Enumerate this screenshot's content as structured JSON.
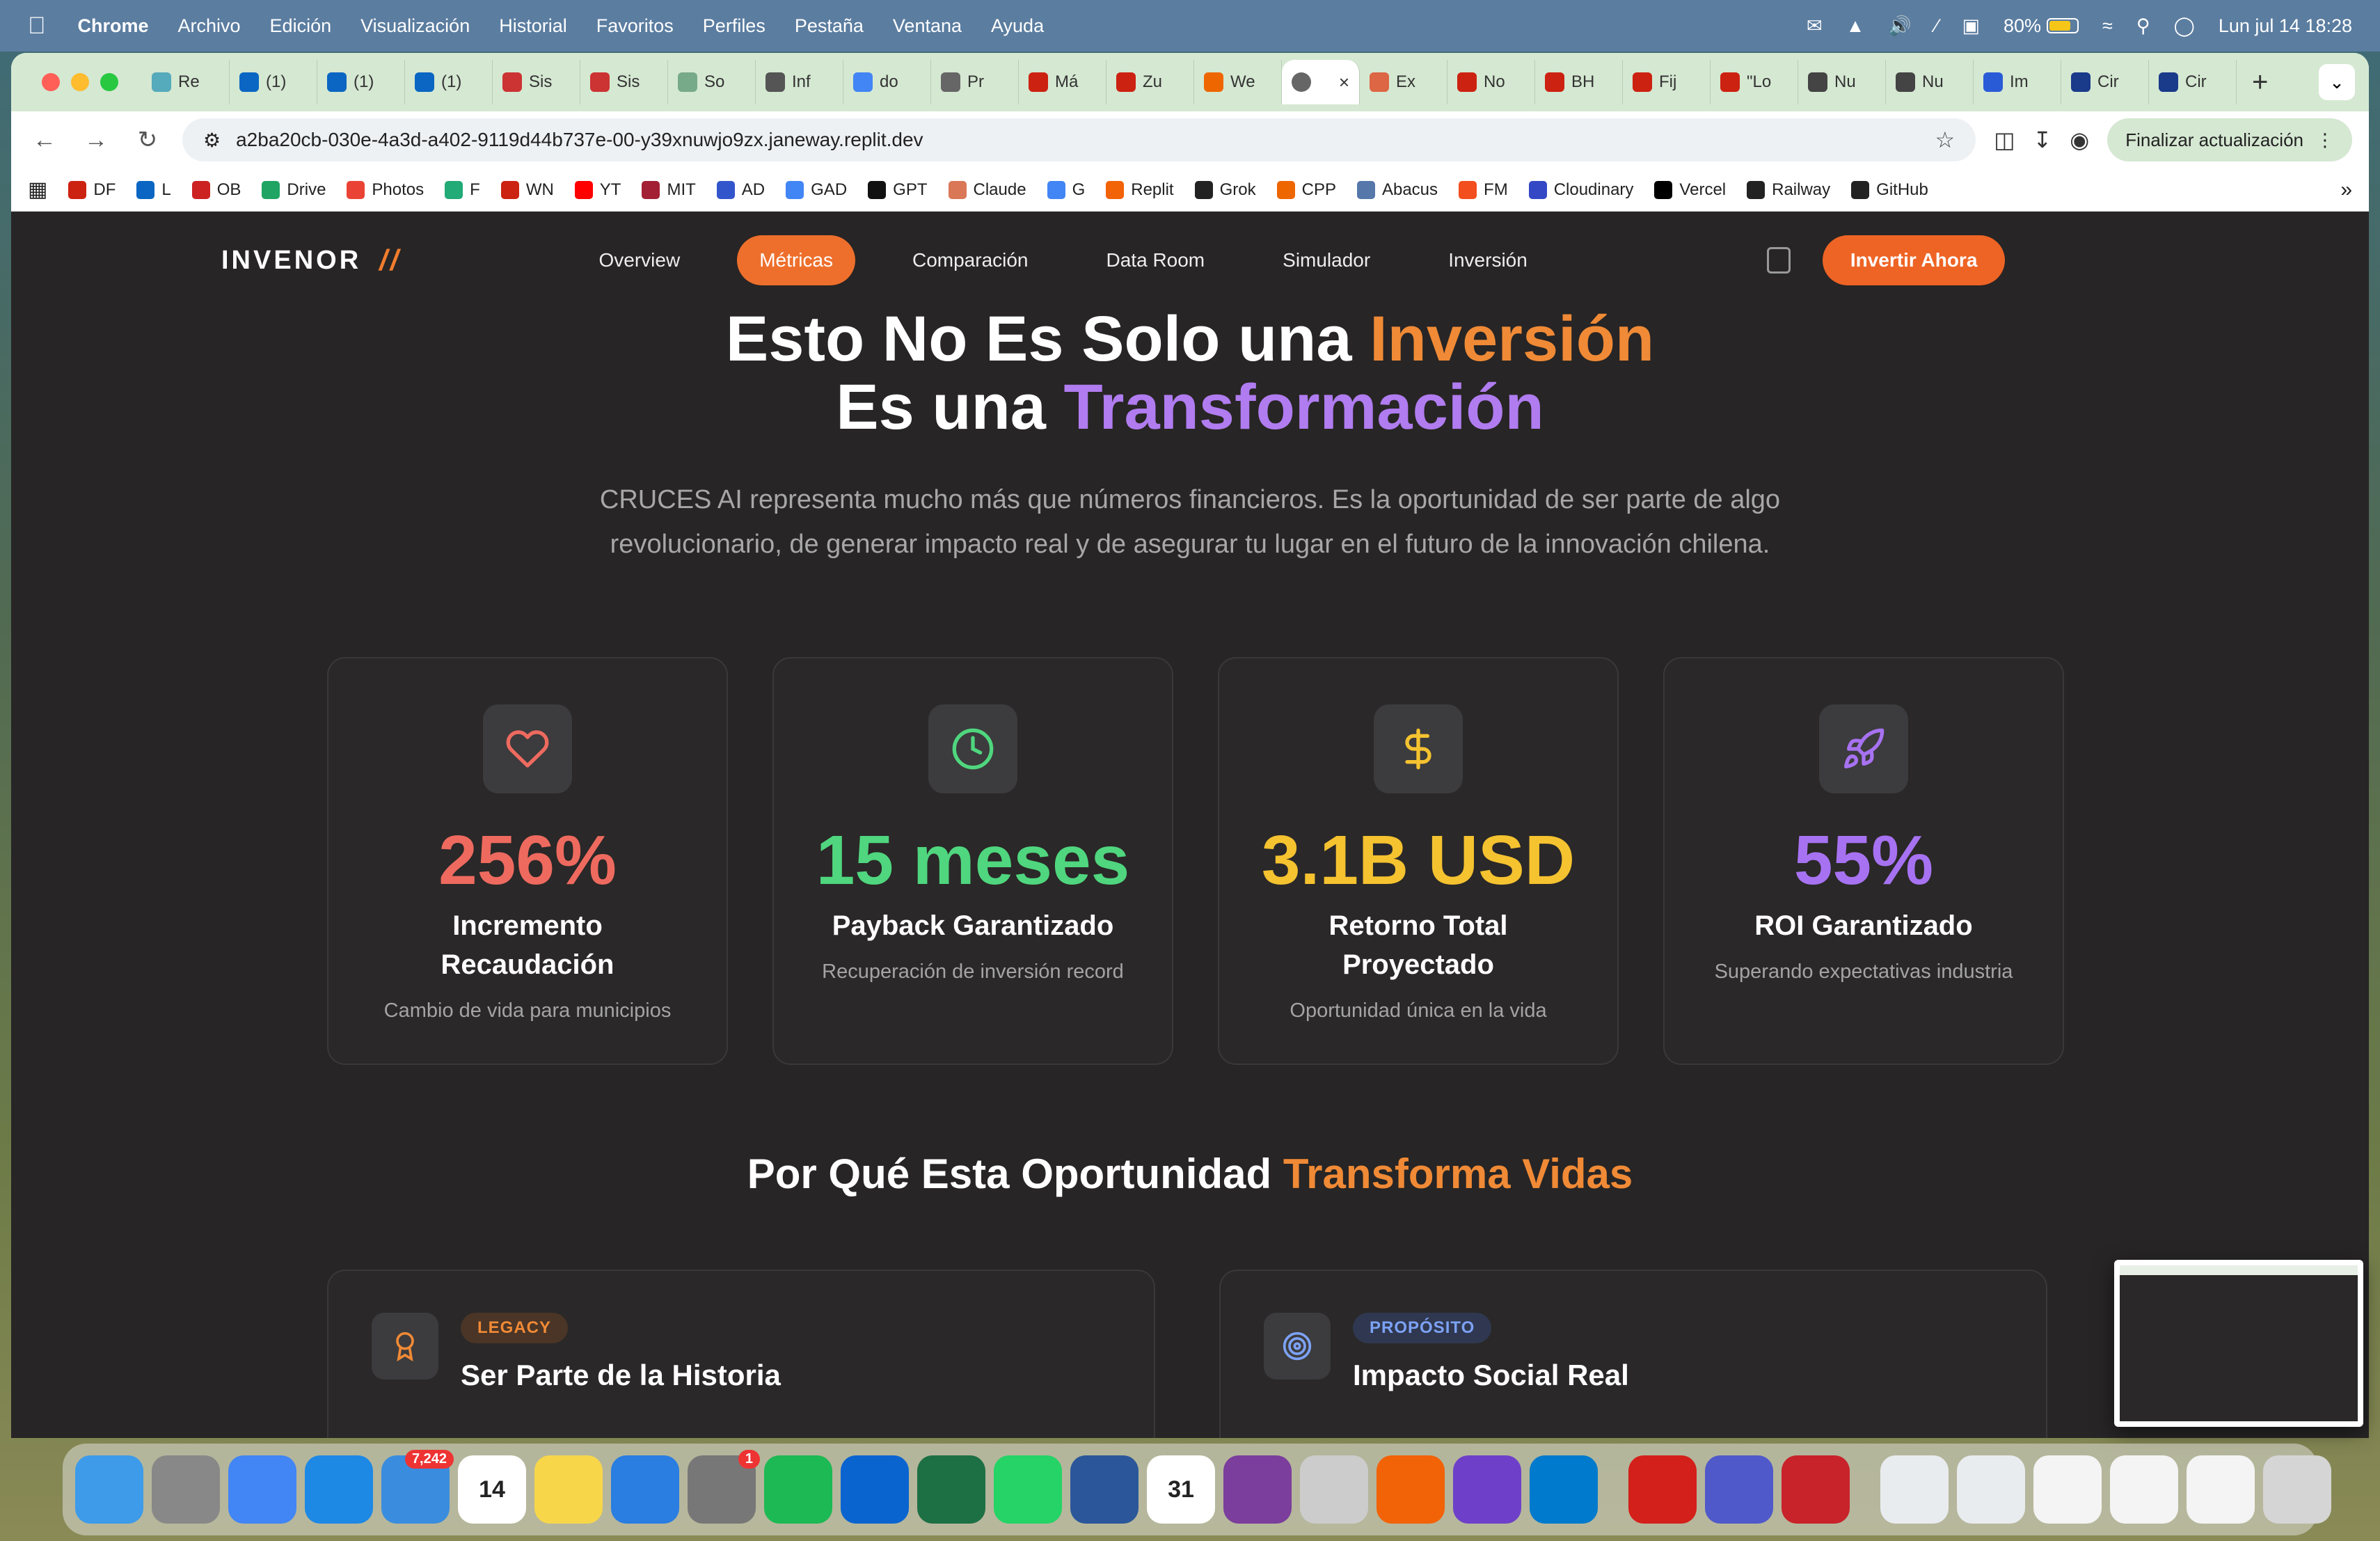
{
  "menubar": {
    "app": "Chrome",
    "items": [
      "Archivo",
      "Edición",
      "Visualización",
      "Historial",
      "Favoritos",
      "Perfiles",
      "Pestaña",
      "Ventana",
      "Ayuda"
    ],
    "battery": "80%",
    "datetime": "Lun jul 14  18:28"
  },
  "tabs": [
    {
      "label": "Re",
      "color": "#5ab"
    },
    {
      "label": "(1)",
      "color": "#0a66c2"
    },
    {
      "label": "(1)",
      "color": "#0a66c2"
    },
    {
      "label": "(1)",
      "color": "#0a66c2"
    },
    {
      "label": "Sis",
      "color": "#c33"
    },
    {
      "label": "Sis",
      "color": "#c33"
    },
    {
      "label": "So",
      "color": "#7a8"
    },
    {
      "label": "Inf",
      "color": "#555"
    },
    {
      "label": "do",
      "color": "#4285f4"
    },
    {
      "label": "Pr",
      "color": "#666"
    },
    {
      "label": "Má",
      "color": "#c21"
    },
    {
      "label": "Zu",
      "color": "#c21"
    },
    {
      "label": "We",
      "color": "#e60"
    },
    {
      "label": "Ex",
      "color": "#d64"
    },
    {
      "label": "No",
      "color": "#c21"
    },
    {
      "label": "BH",
      "color": "#c21"
    },
    {
      "label": "Fij",
      "color": "#c21"
    },
    {
      "label": "\"Lo",
      "color": "#c21"
    },
    {
      "label": "Nu",
      "color": "#444"
    },
    {
      "label": "Nu",
      "color": "#444"
    },
    {
      "label": "Im",
      "color": "#2a5bd7"
    },
    {
      "label": "Cir",
      "color": "#1a3a8a"
    },
    {
      "label": "Cir",
      "color": "#1a3a8a"
    }
  ],
  "active_tab": {
    "label": "",
    "close": "×"
  },
  "address_bar": {
    "url": "a2ba20cb-030e-4a3d-a402-9119d44b737e-00-y39xnuwjo9zx.janeway.replit.dev",
    "update_button": "Finalizar actualización"
  },
  "bookmarks": [
    {
      "label": "DF",
      "color": "#c21"
    },
    {
      "label": "L",
      "color": "#0a66c2"
    },
    {
      "label": "OB",
      "color": "#c22"
    },
    {
      "label": "Drive",
      "color": "#1fa463"
    },
    {
      "label": "Photos",
      "color": "#ea4335"
    },
    {
      "label": "F",
      "color": "#2a7"
    },
    {
      "label": "WN",
      "color": "#c21"
    },
    {
      "label": "YT",
      "color": "#f00"
    },
    {
      "label": "MIT",
      "color": "#a31f34"
    },
    {
      "label": "AD",
      "color": "#35c"
    },
    {
      "label": "GAD",
      "color": "#4285f4"
    },
    {
      "label": "GPT",
      "color": "#111"
    },
    {
      "label": "Claude",
      "color": "#d97757"
    },
    {
      "label": "G",
      "color": "#4285f4"
    },
    {
      "label": "Replit",
      "color": "#f26207"
    },
    {
      "label": "Grok",
      "color": "#222"
    },
    {
      "label": "CPP",
      "color": "#e60"
    },
    {
      "label": "Abacus",
      "color": "#57a"
    },
    {
      "label": "FM",
      "color": "#f24e1e"
    },
    {
      "label": "Cloudinary",
      "color": "#3448c5"
    },
    {
      "label": "Vercel",
      "color": "#000"
    },
    {
      "label": "Railway",
      "color": "#222"
    },
    {
      "label": "GitHub",
      "color": "#222"
    }
  ],
  "site": {
    "logo": "INVENOR",
    "nav": [
      "Overview",
      "Métricas",
      "Comparación",
      "Data Room",
      "Simulador",
      "Inversión"
    ],
    "active_nav": "Métricas",
    "cta": "Invertir Ahora",
    "hero": {
      "line1_a": "Esto No Es Solo una ",
      "line1_b": "Inversión",
      "line2_a": "Es una ",
      "line2_b": "Transformación",
      "lead": "CRUCES AI representa mucho más que números financieros. Es la oportunidad de ser parte de algo revolucionario, de generar impacto real y de asegurar tu lugar en el futuro de la innovación chilena."
    },
    "metrics": [
      {
        "value": "256%",
        "label": "Incremento Recaudación",
        "sub": "Cambio de vida para municipios",
        "color": "#ee6a5f",
        "icon": "heart-icon"
      },
      {
        "value": "15 meses",
        "label": "Payback Garantizado",
        "sub": "Recuperación de inversión record",
        "color": "#4fd67e",
        "icon": "clock-icon"
      },
      {
        "value": "3.1B USD",
        "label": "Retorno Total Proyectado",
        "sub": "Oportunidad única en la vida",
        "color": "#f5c230",
        "icon": "dollar-icon"
      },
      {
        "value": "55%",
        "label": "ROI Garantizado",
        "sub": "Superando expectativas industria",
        "color": "#a772f2",
        "icon": "rocket-icon"
      }
    ],
    "section2": {
      "a": "Por Qué Esta Oportunidad ",
      "b": "Transforma Vidas"
    },
    "reasons": [
      {
        "badge": "LEGACY",
        "title": "Ser Parte de la Historia",
        "badge_color": "#f08a36",
        "badge_bg": "#4a3526",
        "icon": "award-icon"
      },
      {
        "badge": "PROPÓSITO",
        "title": "Impacto Social Real",
        "badge_color": "#7da2f5",
        "badge_bg": "#2f3850",
        "icon": "target-icon"
      }
    ]
  },
  "dock": [
    {
      "name": "finder",
      "color": "#3d9be9",
      "label": ""
    },
    {
      "name": "launchpad",
      "color": "#888",
      "label": ""
    },
    {
      "name": "chrome",
      "color": "#4285f4",
      "label": ""
    },
    {
      "name": "safari",
      "color": "#1e88e5",
      "label": ""
    },
    {
      "name": "mail",
      "color": "#3a8dde",
      "label": "",
      "badge": "7,242"
    },
    {
      "name": "calendar",
      "color": "#fff",
      "label": "14"
    },
    {
      "name": "notes",
      "color": "#f7d64a",
      "label": ""
    },
    {
      "name": "keynote",
      "color": "#2a7de1",
      "label": ""
    },
    {
      "name": "settings",
      "color": "#777",
      "label": "",
      "badge": "1"
    },
    {
      "name": "spotify",
      "color": "#1db954",
      "label": ""
    },
    {
      "name": "outlook",
      "color": "#0a64d0",
      "label": ""
    },
    {
      "name": "excel",
      "color": "#1d7044",
      "label": ""
    },
    {
      "name": "whatsapp",
      "color": "#25d366",
      "label": ""
    },
    {
      "name": "word",
      "color": "#2b579a",
      "label": ""
    },
    {
      "name": "calendar2",
      "color": "#fff",
      "label": "31"
    },
    {
      "name": "obs",
      "color": "#7b3e9c",
      "label": ""
    },
    {
      "name": "notes2",
      "color": "#ccc",
      "label": ""
    },
    {
      "name": "replit",
      "color": "#f26207",
      "label": ""
    },
    {
      "name": "github",
      "color": "#6e40c9",
      "label": ""
    },
    {
      "name": "vscode",
      "color": "#007acc",
      "label": ""
    },
    {
      "name": "acrobat",
      "color": "#d4201a",
      "label": ""
    },
    {
      "name": "teams",
      "color": "#5059c9",
      "label": ""
    },
    {
      "name": "photo-booth",
      "color": "#c8222b",
      "label": ""
    },
    {
      "name": "doc1",
      "color": "#e9ecef",
      "label": ""
    },
    {
      "name": "doc2",
      "color": "#e9ecef",
      "label": ""
    },
    {
      "name": "doc3",
      "color": "#f4f4f4",
      "label": ""
    },
    {
      "name": "doc4",
      "color": "#f4f4f4",
      "label": ""
    },
    {
      "name": "doc5",
      "color": "#f4f4f4",
      "label": ""
    },
    {
      "name": "trash",
      "color": "#d5d5d5",
      "label": ""
    }
  ]
}
